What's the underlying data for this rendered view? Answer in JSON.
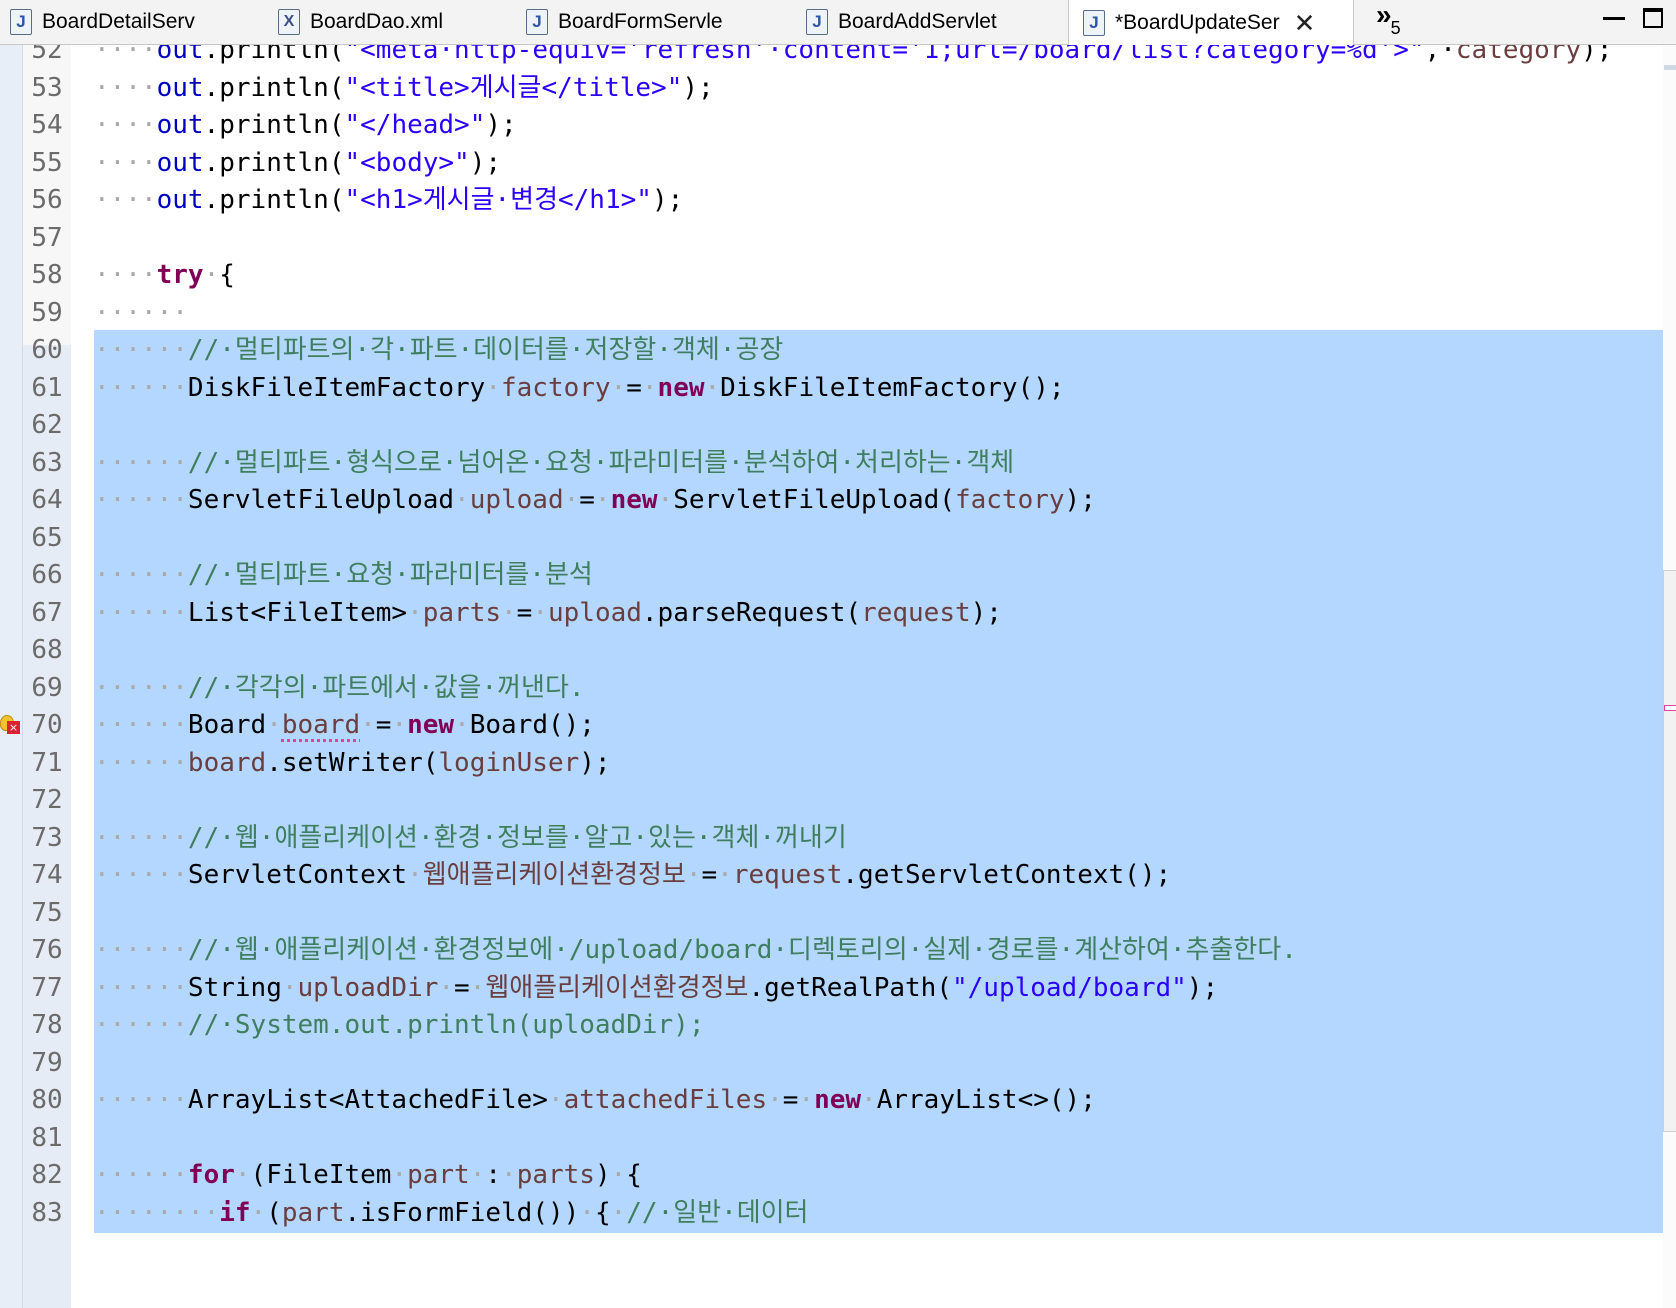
{
  "tabs": [
    {
      "label": "BoardDetailServ",
      "icon": "java-file-icon",
      "glyph": "J",
      "active": false
    },
    {
      "label": "BoardDao.xml",
      "icon": "xml-file-icon",
      "glyph": "X",
      "active": false
    },
    {
      "label": "BoardFormServle",
      "icon": "java-file-icon",
      "glyph": "J",
      "active": false
    },
    {
      "label": "BoardAddServlet",
      "icon": "java-file-icon",
      "glyph": "J",
      "active": false
    },
    {
      "label": "*BoardUpdateSer",
      "icon": "java-file-icon",
      "glyph": "J",
      "active": true
    }
  ],
  "tab_close_glyph": "✕",
  "overflow": {
    "chevron": "»",
    "count": "5"
  },
  "colors": {
    "selection": "#b3d7ff",
    "keyword": "#7f0055",
    "string": "#2a00ff",
    "comment": "#3f7f5f",
    "field": "#0000c0",
    "local_variable": "#6a3e3e"
  },
  "editor": {
    "lines": [
      {
        "num": "52",
        "partial": true,
        "sel": false,
        "tokens": [
          {
            "t": "····",
            "c": "ws"
          },
          {
            "t": "out",
            "c": "fld"
          },
          {
            "t": ".println(",
            "c": ""
          },
          {
            "t": "\"<meta·http-equiv='refresh'·content='1;url=/board/list?category=%d'>\"",
            "c": "str"
          },
          {
            "t": ",·",
            "c": ""
          },
          {
            "t": "category",
            "c": "var"
          },
          {
            "t": ");",
            "c": ""
          }
        ]
      },
      {
        "num": "53",
        "sel": false,
        "tokens": [
          {
            "t": "····",
            "c": "ws"
          },
          {
            "t": "out",
            "c": "fld"
          },
          {
            "t": ".println(",
            "c": ""
          },
          {
            "t": "\"<title>게시글</title>\"",
            "c": "str"
          },
          {
            "t": ");",
            "c": ""
          }
        ]
      },
      {
        "num": "54",
        "sel": false,
        "tokens": [
          {
            "t": "····",
            "c": "ws"
          },
          {
            "t": "out",
            "c": "fld"
          },
          {
            "t": ".println(",
            "c": ""
          },
          {
            "t": "\"</head>\"",
            "c": "str"
          },
          {
            "t": ");",
            "c": ""
          }
        ]
      },
      {
        "num": "55",
        "sel": false,
        "tokens": [
          {
            "t": "····",
            "c": "ws"
          },
          {
            "t": "out",
            "c": "fld"
          },
          {
            "t": ".println(",
            "c": ""
          },
          {
            "t": "\"<body>\"",
            "c": "str"
          },
          {
            "t": ");",
            "c": ""
          }
        ]
      },
      {
        "num": "56",
        "sel": false,
        "tokens": [
          {
            "t": "····",
            "c": "ws"
          },
          {
            "t": "out",
            "c": "fld"
          },
          {
            "t": ".println(",
            "c": ""
          },
          {
            "t": "\"<h1>게시글·변경</h1>\"",
            "c": "str"
          },
          {
            "t": ");",
            "c": ""
          }
        ]
      },
      {
        "num": "57",
        "sel": false,
        "tokens": []
      },
      {
        "num": "58",
        "sel": false,
        "tokens": [
          {
            "t": "····",
            "c": "ws"
          },
          {
            "t": "try",
            "c": "kw"
          },
          {
            "t": "·",
            "c": "ws"
          },
          {
            "t": "{",
            "c": ""
          }
        ]
      },
      {
        "num": "59",
        "sel": false,
        "tokens": [
          {
            "t": "······",
            "c": "ws"
          }
        ]
      },
      {
        "num": "60",
        "sel": true,
        "tokens": [
          {
            "t": "······",
            "c": "ws"
          },
          {
            "t": "//·멀티파트의·각·파트·데이터를·저장할·객체·공장",
            "c": "cmt"
          }
        ]
      },
      {
        "num": "61",
        "sel": true,
        "tokens": [
          {
            "t": "······",
            "c": "ws"
          },
          {
            "t": "DiskFileItemFactory",
            "c": ""
          },
          {
            "t": "·",
            "c": "ws"
          },
          {
            "t": "factory",
            "c": "var"
          },
          {
            "t": "·",
            "c": "ws"
          },
          {
            "t": "=",
            "c": ""
          },
          {
            "t": "·",
            "c": "ws"
          },
          {
            "t": "new",
            "c": "kw"
          },
          {
            "t": "·",
            "c": "ws"
          },
          {
            "t": "DiskFileItemFactory();",
            "c": ""
          }
        ]
      },
      {
        "num": "62",
        "sel": true,
        "tokens": []
      },
      {
        "num": "63",
        "sel": true,
        "tokens": [
          {
            "t": "······",
            "c": "ws"
          },
          {
            "t": "//·멀티파트·형식으로·넘어온·요청·파라미터를·분석하여·처리하는·객체",
            "c": "cmt"
          }
        ]
      },
      {
        "num": "64",
        "sel": true,
        "tokens": [
          {
            "t": "······",
            "c": "ws"
          },
          {
            "t": "ServletFileUpload",
            "c": ""
          },
          {
            "t": "·",
            "c": "ws"
          },
          {
            "t": "upload",
            "c": "var"
          },
          {
            "t": "·",
            "c": "ws"
          },
          {
            "t": "=",
            "c": ""
          },
          {
            "t": "·",
            "c": "ws"
          },
          {
            "t": "new",
            "c": "kw"
          },
          {
            "t": "·",
            "c": "ws"
          },
          {
            "t": "ServletFileUpload(",
            "c": ""
          },
          {
            "t": "factory",
            "c": "var"
          },
          {
            "t": ");",
            "c": ""
          }
        ]
      },
      {
        "num": "65",
        "sel": true,
        "tokens": []
      },
      {
        "num": "66",
        "sel": true,
        "tokens": [
          {
            "t": "······",
            "c": "ws"
          },
          {
            "t": "//·멀티파트·요청·파라미터를·분석",
            "c": "cmt"
          }
        ]
      },
      {
        "num": "67",
        "sel": true,
        "tokens": [
          {
            "t": "······",
            "c": "ws"
          },
          {
            "t": "List<FileItem>",
            "c": ""
          },
          {
            "t": "·",
            "c": "ws"
          },
          {
            "t": "parts",
            "c": "var"
          },
          {
            "t": "·",
            "c": "ws"
          },
          {
            "t": "=",
            "c": ""
          },
          {
            "t": "·",
            "c": "ws"
          },
          {
            "t": "upload",
            "c": "var"
          },
          {
            "t": ".parseRequest(",
            "c": ""
          },
          {
            "t": "request",
            "c": "var"
          },
          {
            "t": ");",
            "c": ""
          }
        ]
      },
      {
        "num": "68",
        "sel": true,
        "tokens": []
      },
      {
        "num": "69",
        "sel": true,
        "tokens": [
          {
            "t": "······",
            "c": "ws"
          },
          {
            "t": "//·각각의·파트에서·값을·꺼낸다.",
            "c": "cmt"
          }
        ]
      },
      {
        "num": "70",
        "sel": true,
        "error": true,
        "tokens": [
          {
            "t": "······",
            "c": "ws"
          },
          {
            "t": "Board",
            "c": ""
          },
          {
            "t": "·",
            "c": "ws"
          },
          {
            "t": "board",
            "c": "var warn"
          },
          {
            "t": "·",
            "c": "ws"
          },
          {
            "t": "=",
            "c": ""
          },
          {
            "t": "·",
            "c": "ws"
          },
          {
            "t": "new",
            "c": "kw"
          },
          {
            "t": "·",
            "c": "ws"
          },
          {
            "t": "Board();",
            "c": ""
          }
        ]
      },
      {
        "num": "71",
        "sel": true,
        "tokens": [
          {
            "t": "······",
            "c": "ws"
          },
          {
            "t": "board",
            "c": "var"
          },
          {
            "t": ".setWriter(",
            "c": ""
          },
          {
            "t": "loginUser",
            "c": "var"
          },
          {
            "t": ");",
            "c": ""
          }
        ]
      },
      {
        "num": "72",
        "sel": true,
        "tokens": []
      },
      {
        "num": "73",
        "sel": true,
        "tokens": [
          {
            "t": "······",
            "c": "ws"
          },
          {
            "t": "//·웹·애플리케이션·환경·정보를·알고·있는·객체·꺼내기",
            "c": "cmt"
          }
        ]
      },
      {
        "num": "74",
        "sel": true,
        "tokens": [
          {
            "t": "······",
            "c": "ws"
          },
          {
            "t": "ServletContext",
            "c": ""
          },
          {
            "t": "·",
            "c": "ws"
          },
          {
            "t": "웹애플리케이션환경정보",
            "c": "var"
          },
          {
            "t": "·",
            "c": "ws"
          },
          {
            "t": "=",
            "c": ""
          },
          {
            "t": "·",
            "c": "ws"
          },
          {
            "t": "request",
            "c": "var"
          },
          {
            "t": ".getServletContext();",
            "c": ""
          }
        ]
      },
      {
        "num": "75",
        "sel": true,
        "tokens": []
      },
      {
        "num": "76",
        "sel": true,
        "tokens": [
          {
            "t": "······",
            "c": "ws"
          },
          {
            "t": "//·웹·애플리케이션·환경정보에·/upload/board·디렉토리의·실제·경로를·계산하여·추출한다.",
            "c": "cmt"
          }
        ]
      },
      {
        "num": "77",
        "sel": true,
        "tokens": [
          {
            "t": "······",
            "c": "ws"
          },
          {
            "t": "String",
            "c": ""
          },
          {
            "t": "·",
            "c": "ws"
          },
          {
            "t": "uploadDir",
            "c": "var"
          },
          {
            "t": "·",
            "c": "ws"
          },
          {
            "t": "=",
            "c": ""
          },
          {
            "t": "·",
            "c": "ws"
          },
          {
            "t": "웹애플리케이션환경정보",
            "c": "var"
          },
          {
            "t": ".getRealPath(",
            "c": ""
          },
          {
            "t": "\"/upload/board\"",
            "c": "str"
          },
          {
            "t": ");",
            "c": ""
          }
        ]
      },
      {
        "num": "78",
        "sel": true,
        "tokens": [
          {
            "t": "······",
            "c": "ws"
          },
          {
            "t": "//·System.out.println(uploadDir);",
            "c": "cmt"
          }
        ]
      },
      {
        "num": "79",
        "sel": true,
        "tokens": []
      },
      {
        "num": "80",
        "sel": true,
        "tokens": [
          {
            "t": "······",
            "c": "ws"
          },
          {
            "t": "ArrayList<AttachedFile>",
            "c": ""
          },
          {
            "t": "·",
            "c": "ws"
          },
          {
            "t": "attachedFiles",
            "c": "var"
          },
          {
            "t": "·",
            "c": "ws"
          },
          {
            "t": "=",
            "c": ""
          },
          {
            "t": "·",
            "c": "ws"
          },
          {
            "t": "new",
            "c": "kw"
          },
          {
            "t": "·",
            "c": "ws"
          },
          {
            "t": "ArrayList<>();",
            "c": ""
          }
        ]
      },
      {
        "num": "81",
        "sel": true,
        "tokens": []
      },
      {
        "num": "82",
        "sel": true,
        "tokens": [
          {
            "t": "······",
            "c": "ws"
          },
          {
            "t": "for",
            "c": "kw"
          },
          {
            "t": "·",
            "c": "ws"
          },
          {
            "t": "(FileItem",
            "c": ""
          },
          {
            "t": "·",
            "c": "ws"
          },
          {
            "t": "part",
            "c": "var"
          },
          {
            "t": "·",
            "c": "ws"
          },
          {
            "t": ":",
            "c": ""
          },
          {
            "t": "·",
            "c": "ws"
          },
          {
            "t": "parts",
            "c": "var"
          },
          {
            "t": ")",
            "c": ""
          },
          {
            "t": "·",
            "c": "ws"
          },
          {
            "t": "{",
            "c": ""
          }
        ]
      },
      {
        "num": "83",
        "sel": true,
        "tokens": [
          {
            "t": "········",
            "c": "ws"
          },
          {
            "t": "if",
            "c": "kw"
          },
          {
            "t": "·",
            "c": "ws"
          },
          {
            "t": "(",
            "c": ""
          },
          {
            "t": "part",
            "c": "var"
          },
          {
            "t": ".isFormField())",
            "c": ""
          },
          {
            "t": "·",
            "c": "ws"
          },
          {
            "t": "{",
            "c": ""
          },
          {
            "t": "·",
            "c": "ws"
          },
          {
            "t": "//·일반·데이터",
            "c": "cmt"
          }
        ]
      }
    ]
  }
}
